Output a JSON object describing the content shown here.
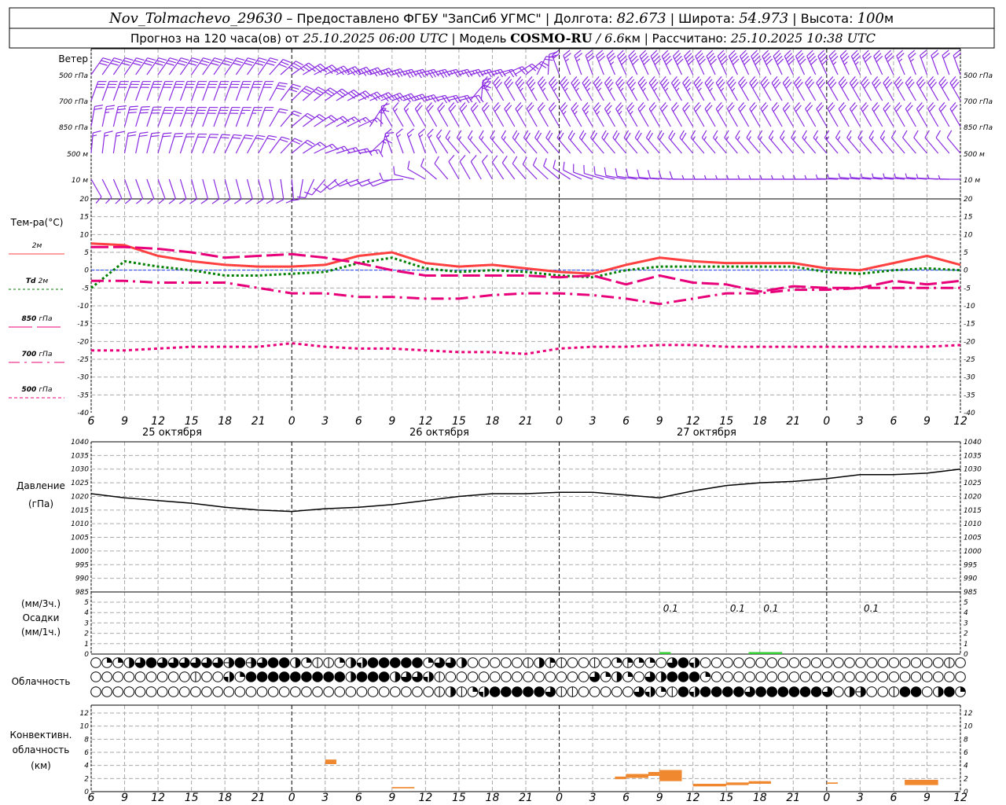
{
  "header": {
    "station": "Nov_Tolmachevo_29630",
    "provider": " – Предоставлено ФГБУ \"ЗапСиб УГМС\" | ",
    "lon_label": "Долгота: ",
    "lon": "82.673",
    "lat_label": " | Широта: ",
    "lat": "54.973",
    "alt_label": " | Высота: ",
    "alt": "100",
    "alt_unit": "м",
    "forecast_label": "Прогноз на 120 часа(ов) от ",
    "forecast_start": "25.10.2025 06:00 UTC",
    "model_label": "  | Модель ",
    "model": "COSMO-RU",
    "resolution": " / 6.6",
    "resolution_unit": "км",
    "computed_label": " | Рассчитано: ",
    "computed": "25.10.2025 10:38 UTC"
  },
  "labels": {
    "wind": "Ветер",
    "wind_levels": [
      "500 гПа",
      "700 гПа",
      "850 гПа",
      "500 м",
      "10 м"
    ],
    "temp_title": "Тем-ра(°C)",
    "legend": [
      {
        "text": "2м",
        "prefix": ""
      },
      {
        "text": "2м",
        "prefix": "Td"
      },
      {
        "text": "гПа",
        "prefix": "850"
      },
      {
        "text": "гПа",
        "prefix": "700"
      },
      {
        "text": "гПа",
        "prefix": "500"
      }
    ],
    "pressure_1": "Давление",
    "pressure_2": "(гПа)",
    "precip_1": "(мм/3ч.)",
    "precip_2": "Осадки",
    "precip_3": "(мм/1ч.)",
    "cloud": "Облачность",
    "conv_1": "Конвективн.",
    "conv_2": "облачность",
    "conv_3": "(км)"
  },
  "colors": {
    "wind": "#8a2be2",
    "t2m": "#ff4040",
    "td2m": "#008000",
    "upper": "#e8007a",
    "zero_line": "#2040ff",
    "precip": "#33cc33",
    "convective": "#f08830",
    "grid": "#aaaaaa"
  },
  "chart_data": {
    "type": "meteogram",
    "x_ticks": [
      "6",
      "9",
      "12",
      "15",
      "18",
      "21",
      "0",
      "3",
      "6",
      "9",
      "12",
      "15",
      "18",
      "21",
      "0",
      "3",
      "6",
      "9",
      "12",
      "15",
      "18",
      "21",
      "0",
      "3",
      "6",
      "9",
      "12"
    ],
    "days": [
      "25 октября",
      "26 октября",
      "27 октября"
    ],
    "times": [
      "2025-10-25T06",
      "2025-10-25T09",
      "2025-10-25T12",
      "2025-10-25T15",
      "2025-10-25T18",
      "2025-10-25T21",
      "2025-10-26T00",
      "2025-10-26T03",
      "2025-10-26T06",
      "2025-10-26T09",
      "2025-10-26T12",
      "2025-10-26T15",
      "2025-10-26T18",
      "2025-10-26T21",
      "2025-10-27T00",
      "2025-10-27T03",
      "2025-10-27T06",
      "2025-10-27T09",
      "2025-10-27T12",
      "2025-10-27T15",
      "2025-10-27T18",
      "2025-10-27T21",
      "2025-10-28T00",
      "2025-10-28T03",
      "2025-10-28T06",
      "2025-10-28T09",
      "2025-10-28T12"
    ],
    "wind": {
      "levels": [
        {
          "name": "500 гПа",
          "dir": [
            35,
            35,
            35,
            35,
            35,
            35,
            55,
            65,
            70,
            75,
            75,
            75,
            75,
            50,
            340,
            340,
            335,
            335,
            335,
            335,
            335,
            335,
            335,
            335,
            335,
            340,
            340
          ],
          "speed": [
            17,
            17,
            17,
            17,
            17,
            17,
            18,
            18,
            18,
            17,
            15,
            14,
            12,
            12,
            12,
            15,
            20,
            20,
            20,
            20,
            20,
            20,
            20,
            18,
            15,
            12,
            12
          ]
        },
        {
          "name": "700 гПа",
          "dir": [
            20,
            20,
            20,
            20,
            20,
            20,
            45,
            55,
            65,
            70,
            75,
            75,
            330,
            330,
            330,
            330,
            330,
            330,
            330,
            330,
            330,
            330,
            330,
            330,
            330,
            330,
            330
          ],
          "speed": [
            15,
            15,
            15,
            15,
            15,
            15,
            15,
            15,
            15,
            15,
            12,
            10,
            15,
            18,
            18,
            18,
            18,
            18,
            18,
            18,
            17,
            17,
            16,
            15,
            15,
            15,
            15
          ]
        },
        {
          "name": "850 гПа",
          "dir": [
            10,
            15,
            20,
            20,
            20,
            20,
            50,
            60,
            65,
            330,
            330,
            330,
            330,
            330,
            330,
            330,
            330,
            330,
            330,
            330,
            330,
            330,
            330,
            330,
            330,
            330,
            330
          ],
          "speed": [
            12,
            15,
            15,
            15,
            15,
            12,
            12,
            10,
            8,
            8,
            10,
            10,
            10,
            12,
            12,
            14,
            14,
            10,
            10,
            10,
            10,
            10,
            10,
            10,
            10,
            10,
            10
          ]
        },
        {
          "name": "500 м",
          "dir": [
            5,
            10,
            15,
            20,
            25,
            30,
            50,
            70,
            80,
            340,
            340,
            320,
            320,
            320,
            320,
            320,
            320,
            320,
            320,
            320,
            320,
            320,
            320,
            320,
            320,
            320,
            320
          ],
          "speed": [
            8,
            10,
            12,
            12,
            12,
            10,
            10,
            8,
            8,
            8,
            8,
            8,
            8,
            10,
            10,
            10,
            10,
            10,
            10,
            8,
            8,
            8,
            8,
            8,
            8,
            6,
            6
          ]
        },
        {
          "name": "10 м",
          "dir": [
            150,
            160,
            160,
            165,
            165,
            165,
            175,
            220,
            250,
            250,
            300,
            330,
            330,
            320,
            310,
            290,
            280,
            275,
            270,
            270,
            270,
            270,
            270,
            275,
            275,
            275,
            270
          ],
          "speed": [
            5,
            5,
            5,
            5,
            5,
            5,
            5,
            5,
            5,
            5,
            5,
            5,
            5,
            5,
            5,
            5,
            5,
            5,
            5,
            4,
            4,
            4,
            4,
            4,
            4,
            4,
            4
          ]
        }
      ]
    },
    "temperature": {
      "ylim": [
        -40,
        20
      ],
      "y_ticks": [
        "20",
        "15",
        "10",
        "5",
        "0",
        "-5",
        "-10",
        "-15",
        "-20",
        "-25",
        "-30",
        "-35",
        "-40"
      ],
      "series": [
        {
          "name": "2м",
          "values": [
            7.5,
            7,
            4,
            2.5,
            1.5,
            1,
            1,
            1.5,
            4,
            5,
            2,
            1,
            1.5,
            0.5,
            -0.5,
            -1,
            1.5,
            3.5,
            2.5,
            2,
            2,
            2,
            0.5,
            0,
            2,
            4,
            1.5
          ]
        },
        {
          "name": "Td 2м",
          "values": [
            -5,
            2.5,
            1,
            0,
            -1.5,
            -1.5,
            -1,
            -0.5,
            2,
            3.5,
            0.5,
            -0.5,
            0,
            -0.5,
            -1.5,
            -2,
            0,
            1,
            1,
            1,
            1,
            1,
            -0.5,
            -1,
            0,
            0.5,
            0
          ]
        },
        {
          "name": "850 гПа",
          "values": [
            6.5,
            6.5,
            6,
            5,
            3.5,
            4,
            4.5,
            3.5,
            2,
            0,
            -1.5,
            -1.5,
            -1.5,
            -1.5,
            -2,
            -1.5,
            -4,
            -1.5,
            -3.5,
            -4,
            -6,
            -4.5,
            -5,
            -5,
            -3,
            -4,
            -3
          ]
        },
        {
          "name": "700 гПа",
          "values": [
            -3,
            -3,
            -3.5,
            -3.5,
            -3.5,
            -5,
            -6.5,
            -6.5,
            -7.5,
            -7.5,
            -8,
            -8,
            -7,
            -6.5,
            -6.5,
            -7,
            -8,
            -9.5,
            -8,
            -6.5,
            -6.5,
            -5.5,
            -5.5,
            -5,
            -5,
            -5,
            -5
          ]
        },
        {
          "name": "500 гПа",
          "values": [
            -22.5,
            -22.5,
            -22,
            -21.5,
            -21.5,
            -21.5,
            -20.5,
            -21.5,
            -22,
            -22,
            -22.5,
            -23,
            -23,
            -23.5,
            -22,
            -21.5,
            -21.5,
            -21,
            -21,
            -21.5,
            -21.5,
            -21.5,
            -21.5,
            -21.5,
            -21.5,
            -21.5,
            -21
          ]
        }
      ]
    },
    "pressure": {
      "ylim": [
        985,
        1040
      ],
      "y_ticks": [
        "1040",
        "1035",
        "1030",
        "1025",
        "1020",
        "1015",
        "1010",
        "1005",
        "1000",
        "995",
        "990",
        "985"
      ],
      "values": [
        1021,
        1019.5,
        1018.5,
        1017.5,
        1016,
        1015,
        1014.5,
        1015.5,
        1016,
        1017,
        1018.5,
        1020,
        1021,
        1021,
        1021.5,
        1021.5,
        1020.5,
        1019.5,
        1022,
        1024,
        1025,
        1025.5,
        1026.5,
        1028,
        1028,
        1028.5,
        1030
      ]
    },
    "precipitation": {
      "ylim": [
        0,
        5
      ],
      "y_ticks": [
        "5",
        "4",
        "3",
        "2",
        "1",
        "0"
      ],
      "bars": [
        {
          "start": "2025-10-27T09",
          "end": "2025-10-27T10",
          "value": 0.1
        },
        {
          "start": "2025-10-27T17",
          "end": "2025-10-27T20",
          "value": 0.1
        }
      ],
      "labels": [
        {
          "time": "2025-10-27T10",
          "text": "0.1"
        },
        {
          "time": "2025-10-27T16",
          "text": "0.1"
        },
        {
          "time": "2025-10-27T19",
          "text": "0.1"
        },
        {
          "time": "2025-10-28T04",
          "text": "0.1"
        }
      ]
    },
    "cloud_octas": {
      "rows": [
        "0224686666665856884211247888882664000001431001023220687000000000000000000000010",
        "0000000001007288888888848884667100000000000006242064888200000000000000000000000",
        "0000000000000000000000000000000141278888861100000672187888868888886045001880482"
      ]
    },
    "convective": {
      "ylim": [
        0,
        13
      ],
      "y_ticks": [
        "12",
        "10",
        "8",
        "6",
        "4",
        "2",
        "0"
      ],
      "bars": [
        {
          "start": "2025-10-26T03",
          "end": "2025-10-26T04",
          "base": 4.2,
          "top": 4.9
        },
        {
          "start": "2025-10-26T09",
          "end": "2025-10-26T11",
          "base": 0.5,
          "top": 0.7
        },
        {
          "start": "2025-10-27T05",
          "end": "2025-10-27T06",
          "base": 1.9,
          "top": 2.3
        },
        {
          "start": "2025-10-27T06",
          "end": "2025-10-27T08",
          "base": 2.1,
          "top": 2.7
        },
        {
          "start": "2025-10-27T08",
          "end": "2025-10-27T09",
          "base": 2.4,
          "top": 3.0
        },
        {
          "start": "2025-10-27T09",
          "end": "2025-10-27T11",
          "base": 1.6,
          "top": 3.3
        },
        {
          "start": "2025-10-27T12",
          "end": "2025-10-27T15",
          "base": 0.8,
          "top": 1.2
        },
        {
          "start": "2025-10-27T15",
          "end": "2025-10-27T17",
          "base": 1.0,
          "top": 1.4
        },
        {
          "start": "2025-10-27T17",
          "end": "2025-10-27T19",
          "base": 1.2,
          "top": 1.6
        },
        {
          "start": "2025-10-28T00",
          "end": "2025-10-28T01",
          "base": 1.2,
          "top": 1.4
        },
        {
          "start": "2025-10-28T07",
          "end": "2025-10-28T10",
          "base": 1.0,
          "top": 1.8
        }
      ]
    }
  }
}
